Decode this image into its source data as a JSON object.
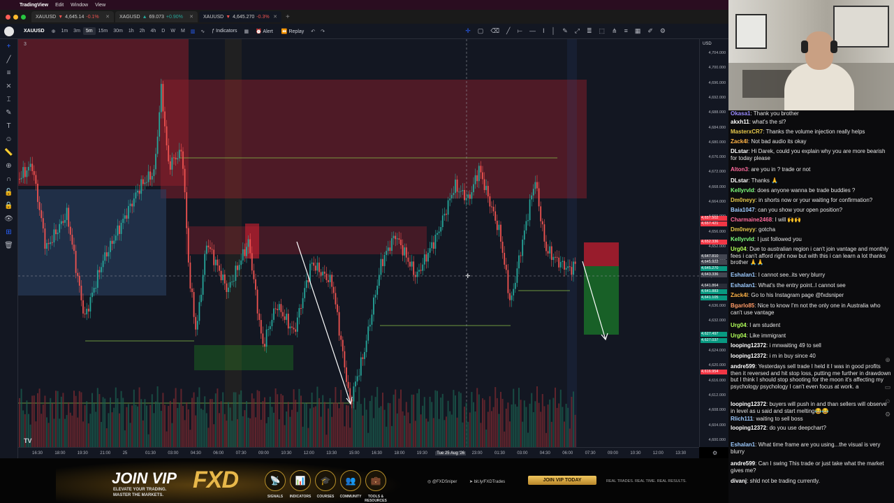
{
  "menubar": {
    "app": "TradingView",
    "items": [
      "Edit",
      "Window",
      "View"
    ]
  },
  "tabs": [
    {
      "symbol": "XAUUSD",
      "price": "4,645.14",
      "change": "-0.1%",
      "dir": "down"
    },
    {
      "symbol": "XAGUSD",
      "price": "69.073",
      "change": "+0.90%",
      "dir": "up"
    },
    {
      "symbol": "XAUUSD",
      "price": "4,645.270",
      "change": "-0.3%",
      "dir": "down"
    }
  ],
  "toolbar": {
    "symbol": "XAUUSD",
    "timeframes": [
      "1m",
      "3m",
      "5m",
      "15m",
      "30m",
      "1h",
      "2h",
      "4h",
      "D",
      "W",
      "M"
    ],
    "selected_tf": "5m",
    "indicators_label": "Indicators",
    "alert_label": "Alert",
    "replay_label": "Replay"
  },
  "chart": {
    "legend_count": "3",
    "currency": "USD",
    "price_labels": [
      "4,704.000",
      "4,700.000",
      "4,696.000",
      "4,692.000",
      "4,688.000",
      "4,684.000",
      "4,680.000",
      "4,676.000",
      "4,672.000",
      "4,668.000",
      "4,664.000",
      "4,660.000",
      "4,656.000",
      "4,652.000",
      "4,648.000",
      "4,644.000",
      "4,640.000",
      "4,636.000",
      "4,632.000",
      "4,628.000",
      "4,624.000",
      "4,620.000",
      "4,616.000",
      "4,612.000",
      "4,608.000",
      "4,604.000",
      "4,600.000"
    ],
    "price_tags": [
      {
        "text": "4,657.502",
        "color": "#f23645"
      },
      {
        "text": "4,657.421",
        "color": "#f23645"
      },
      {
        "text": "4,652.336",
        "color": "#f23645"
      },
      {
        "text": "4,647.810",
        "color": "#434651"
      },
      {
        "text": "4,645.922",
        "color": "#434651"
      },
      {
        "text": "4,645.270",
        "color": "#089981"
      },
      {
        "text": "4,643.336",
        "color": "#434651"
      },
      {
        "text": "4,641.864",
        "color": "#2a2e39"
      },
      {
        "text": "4,641.883",
        "color": "#089981"
      },
      {
        "text": "4,641.105",
        "color": "#089981"
      },
      {
        "text": "4,627.497",
        "color": "#089981"
      },
      {
        "text": "4,627.037",
        "color": "#089981"
      },
      {
        "text": "4,616.954",
        "color": "#f23645"
      }
    ],
    "time_labels": [
      "16:30",
      "18:00",
      "19:30",
      "21:00",
      "25",
      "01:30",
      "03:00",
      "04:30",
      "06:00",
      "07:30",
      "09:00",
      "10:30",
      "12:00",
      "13:30",
      "15:00",
      "16:30",
      "18:00",
      "19:30",
      "Tue 25 Aug '26",
      "23:00",
      "01:30",
      "03:00",
      "04:30",
      "06:00",
      "07:30",
      "09:00",
      "10:30",
      "12:00",
      "13:30"
    ],
    "time_highlight": "Tue 25 Aug '26",
    "tv_logo": "TV"
  },
  "banner": {
    "join": "JOIN VIP",
    "sub1": "ELEVATE YOUR TRADING.",
    "sub2": "MASTER THE MARKETS.",
    "brand": "FXD",
    "features": [
      "SIGNALS",
      "INDICATORS",
      "COURSES",
      "COMMUNITY",
      "TOOLS & RESOURCES"
    ],
    "instagram": "@FXDSniper",
    "telegram": "bit.ly/FXDTrades",
    "vip_button": "JOIN VIP TODAY",
    "tagline": "REAL TRADES. REAL TIME. REAL RESULTS."
  },
  "chat": [
    {
      "user": "Okasa1",
      "color": "#9b8cff",
      "text": "Thank you brother"
    },
    {
      "user": "akxh11",
      "color": "#ffffff",
      "text": "what's the sl?"
    },
    {
      "user": "MasterxCR7",
      "color": "#e6c84c",
      "text": "Thanks the volume injection really helps"
    },
    {
      "user": "Zack4l",
      "color": "#ffb347",
      "text": "Not bad audio its okay"
    },
    {
      "user": "DLstar",
      "color": "#ffffff",
      "text": "Hi Darek, could you explain why you are more bearish for today please"
    },
    {
      "user": "Alton3",
      "color": "#ff6b9d",
      "text": "are you in ? trade or not"
    },
    {
      "user": "DLstar",
      "color": "#ffffff",
      "text": "Thanks 🙏"
    },
    {
      "user": "Kellyrvld",
      "color": "#7fff7f",
      "text": "does anyone wanna be trade buddies ?"
    },
    {
      "user": "Dm0neyy",
      "color": "#e6c84c",
      "text": "in shorts now or your waiting for confirmation?"
    },
    {
      "user": "Baia1047",
      "color": "#9ecbff",
      "text": "can you show your open position?"
    },
    {
      "user": "Charmaine2468",
      "color": "#ff6b9d",
      "text": "I will 🙌🙌"
    },
    {
      "user": "Dm0neyy",
      "color": "#e6c84c",
      "text": "gotcha"
    },
    {
      "user": "Kellyrvld",
      "color": "#7fff7f",
      "text": "I just followed you"
    },
    {
      "user": "Urg04",
      "color": "#b2ff59",
      "text": "Due to australian region i can't join vantage and monthly fees i can't afford right now but with this i can learn a lot thanks brother 🙏🙏"
    },
    {
      "user": "Eshalan1",
      "color": "#9ecbff",
      "text": "I cannot see..its very blurry"
    },
    {
      "user": "Eshalan1",
      "color": "#9ecbff",
      "text": "What's the entry point..I cannot see"
    },
    {
      "user": "Zack4l",
      "color": "#ffb347",
      "text": "Go to his Instagram page @fxdsniper"
    },
    {
      "user": "Bgarlo85",
      "color": "#ff9a66",
      "text": "Nice to know I'm not the only one in Australia who can't use vantage"
    },
    {
      "user": "Urg04",
      "color": "#b2ff59",
      "text": "I am student"
    },
    {
      "user": "Urg04",
      "color": "#b2ff59",
      "text": "Like immigrant"
    },
    {
      "user": "looping12372",
      "color": "#ffffff",
      "text": "i mnwaiting 49 to sell"
    },
    {
      "user": "looping12372",
      "color": "#ffffff",
      "text": "i m in buy since 40"
    },
    {
      "user": "andre599",
      "color": "#ffffff",
      "text": "Yesterdays sell trade I held it I was in good profits then it reversed and hit stop loss, putting me further in drawdown but I think I should stop shooting for the moon it's affecting my psychology psychology I can't even focus at work. a"
    },
    {
      "user": "looping12372",
      "color": "#ffffff",
      "text": "buyers will push in and than sellers will observe in level as u said and start melting😂😂"
    },
    {
      "user": "Rlich111",
      "color": "#9ecbff",
      "text": "waiting to sell boss"
    },
    {
      "user": "looping12372",
      "color": "#ffffff",
      "text": "do you use deepchart?"
    },
    {
      "user": "Eshalan1",
      "color": "#9ecbff",
      "text": "What time frame are you using...the visual is very blurry"
    },
    {
      "user": "andre599",
      "color": "#ffffff",
      "text": "Can I swing This trade or just take what the market gives me?"
    },
    {
      "user": "divanj",
      "color": "#ffffff",
      "text": "shld not be trading currently."
    }
  ]
}
